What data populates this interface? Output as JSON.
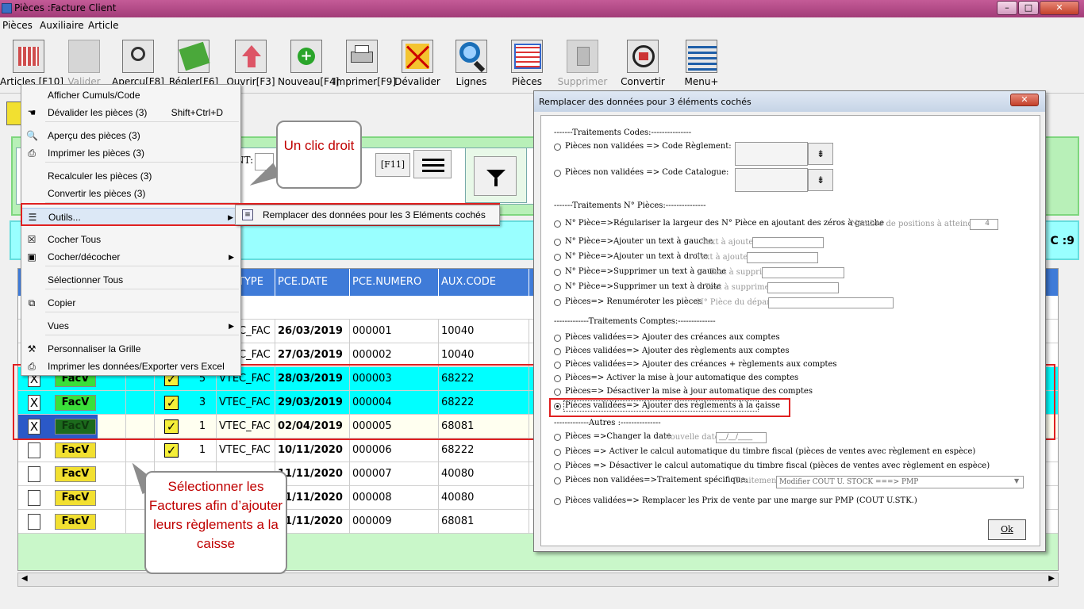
{
  "window": {
    "title": "Pièces :Facture Client",
    "minimize": "–",
    "maximize": "□",
    "close": "✕"
  },
  "menubar": [
    "Pièces",
    "Auxiliaire",
    "Article"
  ],
  "toolbar": [
    {
      "label": "Articles [F10]",
      "icon": "grid-icon",
      "disabled": false
    },
    {
      "label": "Valider",
      "icon": "blank-icon",
      "disabled": true
    },
    {
      "label": "Aperçu[F8]",
      "icon": "magnifier-doc-icon",
      "disabled": false
    },
    {
      "label": "Régler[F6]",
      "icon": "money-icon",
      "disabled": false
    },
    {
      "label": "Ouvrir[F3]",
      "icon": "up-arrow-icon",
      "disabled": false
    },
    {
      "label": "Nouveau[F4]",
      "icon": "add-icon",
      "disabled": false
    },
    {
      "label": "Imprimer[F9]",
      "icon": "printer-icon",
      "disabled": false
    },
    {
      "label": "Dévalider",
      "icon": "cross-icon",
      "disabled": false
    },
    {
      "label": "Lignes",
      "icon": "search-icon",
      "disabled": false
    },
    {
      "label": "Pièces",
      "icon": "table-icon",
      "disabled": false
    },
    {
      "label": "Supprimer",
      "icon": "trash-icon",
      "disabled": true
    },
    {
      "label": "Convertir",
      "icon": "convert-icon",
      "disabled": false
    },
    {
      "label": "Menu+",
      "icon": "lines-icon",
      "disabled": false
    }
  ],
  "filter_panel": {
    "field_label": "NT:",
    "key_label": "[F11]"
  },
  "right_edge_text": "C :9",
  "grid": {
    "columns": [
      "TYPE",
      "PCE.DATE",
      "PCE.NUMERO",
      "AUX.CODE"
    ],
    "rows": [
      {
        "checked": "",
        "badge": "FacV",
        "valid": true,
        "n": "",
        "type": "VTEC_FAC",
        "date": "26/03/2019",
        "numero": "000001",
        "aux": "10040",
        "style": "hidden"
      },
      {
        "checked": "",
        "badge": "FacV",
        "valid": true,
        "n": "",
        "type": "VTEC_FAC",
        "date": "27/03/2019",
        "numero": "000002",
        "aux": "10040",
        "style": "hidden"
      },
      {
        "checked": "X",
        "badge": "FacV",
        "valid": true,
        "n": "5",
        "type": "VTEC_FAC",
        "date": "28/03/2019",
        "numero": "000003",
        "aux": "68222",
        "style": "cyan"
      },
      {
        "checked": "X",
        "badge": "FacV",
        "valid": true,
        "n": "3",
        "type": "VTEC_FAC",
        "date": "29/03/2019",
        "numero": "000004",
        "aux": "68222",
        "style": "cyan"
      },
      {
        "checked": "X",
        "badge": "FacV",
        "valid": true,
        "n": "1",
        "type": "VTEC_FAC",
        "date": "02/04/2019",
        "numero": "000005",
        "aux": "68081",
        "style": "selected"
      },
      {
        "checked": "",
        "badge": "FacV",
        "valid": true,
        "n": "1",
        "type": "VTEC_FAC",
        "date": "10/11/2020",
        "numero": "000006",
        "aux": "68222",
        "style": "white"
      },
      {
        "checked": "",
        "badge": "FacV",
        "valid": false,
        "n": "",
        "type": "",
        "date": "11/11/2020",
        "numero": "000007",
        "aux": "40080",
        "style": "white"
      },
      {
        "checked": "",
        "badge": "FacV",
        "valid": false,
        "n": "",
        "type": "",
        "date": "11/11/2020",
        "numero": "000008",
        "aux": "40080",
        "style": "white"
      },
      {
        "checked": "",
        "badge": "FacV",
        "valid": false,
        "n": "",
        "type": "",
        "date": "11/11/2020",
        "numero": "000009",
        "aux": "68081",
        "style": "white"
      }
    ]
  },
  "context_menu": {
    "items": [
      {
        "label": "Afficher Cumuls/Code",
        "icon": "",
        "shortcut": "",
        "submenu": false
      },
      {
        "label": "Dévalider les pièces (3)",
        "icon": "hand-icon",
        "shortcut": "Shift+Ctrl+D",
        "submenu": false
      },
      {
        "label": "Aperçu des pièces  (3)",
        "icon": "magnifier-icon",
        "shortcut": "",
        "submenu": false
      },
      {
        "label": "Imprimer les pièces (3)",
        "icon": "printer-icon",
        "shortcut": "",
        "submenu": false
      },
      {
        "label": "Recalculer les pièces  (3)",
        "icon": "",
        "shortcut": "",
        "submenu": false
      },
      {
        "label": "Convertir les pièces  (3)",
        "icon": "",
        "shortcut": "",
        "submenu": false
      },
      {
        "label": "Outils...",
        "icon": "list-icon",
        "shortcut": "",
        "submenu": true
      },
      {
        "label": "Cocher Tous",
        "icon": "checkbox-x-icon",
        "shortcut": "",
        "submenu": false
      },
      {
        "label": "Cocher/décocher",
        "icon": "checkbox-icon",
        "shortcut": "",
        "submenu": true
      },
      {
        "label": "Sélectionner Tous",
        "icon": "",
        "shortcut": "",
        "submenu": false
      },
      {
        "label": "Copier",
        "icon": "copy-icon",
        "shortcut": "",
        "submenu": false
      },
      {
        "label": "Vues",
        "icon": "",
        "shortcut": "",
        "submenu": true
      },
      {
        "label": "Personnaliser la Grille",
        "icon": "tools-icon",
        "shortcut": "",
        "submenu": false
      },
      {
        "label": "Imprimer les données/Exporter vers Excel",
        "icon": "printer-icon",
        "shortcut": "",
        "submenu": false
      }
    ]
  },
  "submenu": {
    "label": "Remplacer des données pour les 3 Eléments cochés"
  },
  "callouts": {
    "right_click": "Un clic droit",
    "select_invoices": "Sélectionner les Factures afin d’ajouter leurs règlements a la caisse"
  },
  "dialog": {
    "title": "Remplacer des données pour 3 éléments cochés",
    "close": "✕",
    "sections": {
      "codes": "-------Traitements Codes:---------------",
      "numeros": "-------Traitements N° Pièces:---------------",
      "comptes": "-------------Traitements Comptes:--------------",
      "autres": "-------------Autres :---------------"
    },
    "options": {
      "code_reglement": "Pièces non validées => Code Règlement:",
      "code_catalogue": "Pièces non validées => Code Catalogue:",
      "regulariser": "N° Pièce=>Régulariser la largeur des N° Pièce en ajoutant des zéros à gauche",
      "regulariser_hint": "Nombre de positions à atteindre",
      "regulariser_value": "4",
      "add_left": "N° Pièce=>Ajouter un text à gauche",
      "add_left_hint": "Text à ajouter",
      "add_right": "N° Pièce=>Ajouter un text à droite",
      "add_right_hint": "Text à ajouter",
      "del_left": "N° Pièce=>Supprimer un text à gauche",
      "del_left_hint": "Text à supprimer",
      "del_right": "N° Pièce=>Supprimer un text à droite",
      "del_right_hint": "Text à supprimer",
      "renumber": "Pièces=> Renuméroter les pièces",
      "renumber_hint": "N° Pièce du départ",
      "creances": "Pièces validées=> Ajouter des créances aux comptes",
      "reglements": "Pièces validées=> Ajouter des règlements aux comptes",
      "creances_reglements": "Pièces validées=> Ajouter des créances + règlements  aux comptes",
      "activer_maj": "Pièces=> Activer la mise à jour automatique des comptes",
      "desactiver_maj": "Pièces=> Désactiver la mise à jour automatique des comptes",
      "caisse": "Pièces validées=> Ajouter des règlements à la caisse",
      "changer_date": "Pièces =>Changer la date",
      "changer_date_hint": "Nouvelle date",
      "date_value": "__/__/____",
      "activer_timbre": "Pièces => Activer le calcul automatique  du timbre fiscal (pièces de ventes avec règlement en espèce)",
      "desactiver_timbre": "Pièces => Désactiver le calcul automatique  du timbre fiscal (pièces de ventes avec règlement en espèce)",
      "traitement_specifique": "Pièces non validées=>Traitement spécifique:",
      "traitement_hint": "Traitement",
      "traitement_value": "Modifier COUT U. STOCK ===> PMP",
      "remplacer_prix": "Pièces validées=> Remplacer les Prix de vente par une marge sur PMP (COUT U.STK.)"
    },
    "selected_option": "caisse",
    "ok": "Ok"
  },
  "colors": {
    "title_bar": "#b44a88",
    "grid_header": "#3f7bd8",
    "selected_row": "#99ffff",
    "callout_text": "#c00000",
    "highlight_box": "#e02020"
  }
}
